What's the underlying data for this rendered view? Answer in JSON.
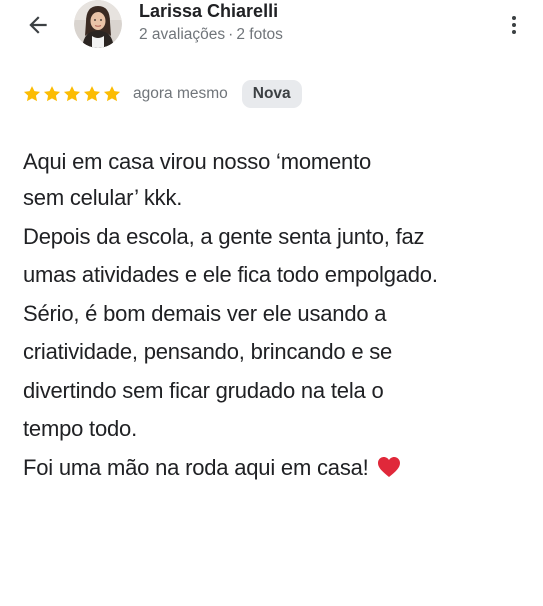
{
  "header": {
    "back_icon": "arrow-left-icon",
    "author": {
      "name": "Larissa Chiarelli",
      "reviews_count": "2 avaliações",
      "separator": "·",
      "photos_count": "2 fotos"
    },
    "more_icon": "more-vert-icon"
  },
  "rating": {
    "stars": 5,
    "max_stars": 5,
    "star_color": "#fbbc04",
    "timestamp": "agora mesmo",
    "badge": "Nova"
  },
  "review": {
    "lines": [
      "Aqui em casa virou nosso ‘momento",
      "sem celular’ kkk.",
      "Depois da escola, a gente senta junto, faz",
      "umas atividades e ele fica todo empolgado.",
      "Sério, é bom demais ver ele usando a",
      "criatividade, pensando, brincando e se",
      "divertindo sem ficar grudado na tela o",
      "tempo todo.",
      "Foi uma mão na roda aqui em casa!"
    ],
    "emoji_icon": "red-heart-icon",
    "heart_color": "#e0283a"
  }
}
